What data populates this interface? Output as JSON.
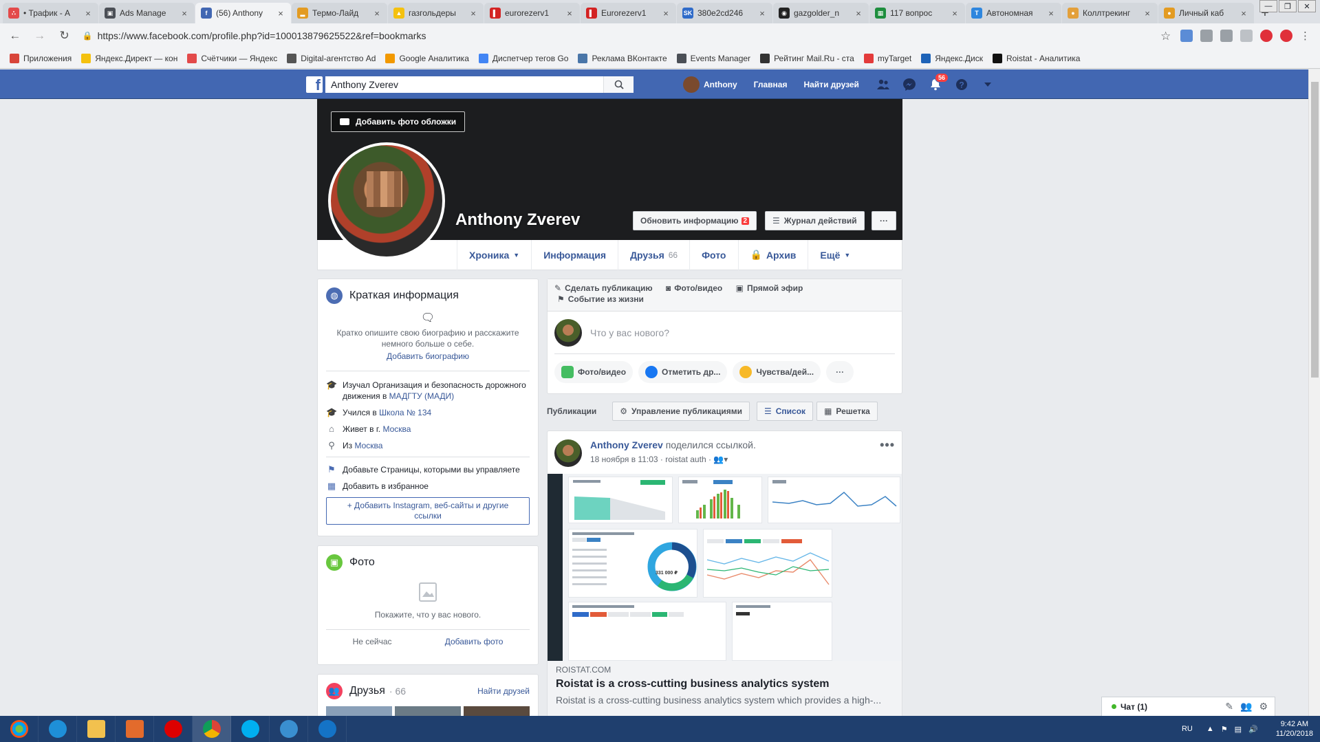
{
  "tabs": [
    {
      "title": "• Трафик - А",
      "color": "#e34a4a",
      "glyph": "∴"
    },
    {
      "title": "Ads Manage",
      "color": "#4b4f56",
      "glyph": "▣"
    },
    {
      "title": "(56) Anthony",
      "color": "#4267b2",
      "glyph": "f",
      "active": true
    },
    {
      "title": "Термо-Лайд",
      "color": "#e39b22",
      "glyph": "▂"
    },
    {
      "title": "газгольдеры",
      "color": "#f4c10f",
      "glyph": "▲"
    },
    {
      "title": "eurorezerv1",
      "color": "#d32323",
      "glyph": "▌"
    },
    {
      "title": "Eurorezerv1",
      "color": "#d32323",
      "glyph": "▌"
    },
    {
      "title": "380e2cd246",
      "color": "#2f6bc9",
      "glyph": "SK"
    },
    {
      "title": "gazgolder_n",
      "color": "#222",
      "glyph": "◉"
    },
    {
      "title": "117 вопрос",
      "color": "#1e8e3e",
      "glyph": "▦"
    },
    {
      "title": "Автономная",
      "color": "#2e86de",
      "glyph": "T"
    },
    {
      "title": "Коллтрекинг",
      "color": "#e3a03b",
      "glyph": "●"
    },
    {
      "title": "Личный каб",
      "color": "#e39b22",
      "glyph": "●"
    }
  ],
  "browser": {
    "url": "https://www.facebook.com/profile.php?id=100013879625522&ref=bookmarks"
  },
  "bookmarks": [
    {
      "label": "Приложения",
      "color": "#d8453a"
    },
    {
      "label": "Яндекс.Директ — кон",
      "color": "#f4c10f"
    },
    {
      "label": "Счётчики — Яндекс",
      "color": "#e34a4a"
    },
    {
      "label": "Digital-агентство Ad",
      "color": "#555"
    },
    {
      "label": "Google Аналитика",
      "color": "#f29900"
    },
    {
      "label": "Диспетчер тегов Go",
      "color": "#4285f4"
    },
    {
      "label": "Реклама ВКонтакте",
      "color": "#4a76a8"
    },
    {
      "label": "Events Manager",
      "color": "#4b4f56"
    },
    {
      "label": "Рейтинг Mail.Ru - ста",
      "color": "#333"
    },
    {
      "label": "myTarget",
      "color": "#e33b3b"
    },
    {
      "label": "Яндекс.Диск",
      "color": "#1e63b8"
    },
    {
      "label": "Roistat - Аналитика",
      "color": "#111"
    }
  ],
  "fb": {
    "search_value": "Anthony Zverev",
    "user_name": "Anthony",
    "home": "Главная",
    "find_friends": "Найти друзей",
    "notif_count": "56"
  },
  "profile": {
    "add_cover": "Добавить фото обложки",
    "name": "Anthony Zverev",
    "update_info": "Обновить информацию",
    "update_badge": "2",
    "activity_log": "Журнал действий",
    "more_dots": "···",
    "tabs": [
      {
        "label": "Хроника",
        "caret": true
      },
      {
        "label": "Информация"
      },
      {
        "label": "Друзья",
        "count": "66"
      },
      {
        "label": "Фото"
      },
      {
        "label": "Архив",
        "lock": true
      },
      {
        "label": "Ещё",
        "caret": true
      }
    ]
  },
  "intro": {
    "title": "Краткая информация",
    "bio_prompt": "Кратко опишите свою биографию и расскажите немного больше о себе.",
    "add_bio": "Добавить биографию",
    "rows": [
      {
        "text": "Изучал Организация и безопасность дорожного движения в",
        "link": "МАДГТУ (МАДИ)",
        "icon": "🎓"
      },
      {
        "text": "Учился в",
        "link": "Школа № 134",
        "icon": "🎓"
      },
      {
        "text": "Живет в г.",
        "link": "Москва",
        "icon": "⌂"
      },
      {
        "text": "Из",
        "link": "Москва",
        "icon": "⚲"
      }
    ],
    "add_pages": "Добавьте Страницы, которыми вы управляете",
    "add_featured": "Добавить в избранное",
    "add_links": "+ Добавить Instagram, веб-сайты и другие ссылки"
  },
  "photos": {
    "title": "Фото",
    "empty": "Покажите, что у вас нового.",
    "not_now": "Не сейчас",
    "add_photo": "Добавить фото"
  },
  "friends": {
    "title": "Друзья",
    "count": "· 66",
    "find": "Найти друзей"
  },
  "composer": {
    "make_post": "Сделать публикацию",
    "photo_video": "Фото/видео",
    "live": "Прямой эфир",
    "life_event": "Событие из жизни",
    "placeholder": "Что у вас нового?",
    "pill_photo": "Фото/видео",
    "pill_tag": "Отметить др...",
    "pill_feel": "Чувства/дей...",
    "pill_more": "···"
  },
  "publications": {
    "label": "Публикации",
    "manage": "Управление публикациями",
    "list": "Список",
    "grid": "Решетка"
  },
  "post": {
    "author": "Anthony Zverev",
    "action": "поделился ссылкой.",
    "time": "18 ноября в 11:03",
    "via": "roistat auth",
    "dots": "•••",
    "link_domain": "ROISTAT.COM",
    "link_title": "Roistat is a cross-cutting business analytics system",
    "link_desc": "Roistat is a cross-cutting business analytics system which provides a high-...",
    "donut_value": "331 000 ₽"
  },
  "chat": {
    "label": "Чат (1)"
  },
  "taskbar": {
    "lang": "RU",
    "time": "9:42 AM",
    "date": "11/20/2018"
  }
}
